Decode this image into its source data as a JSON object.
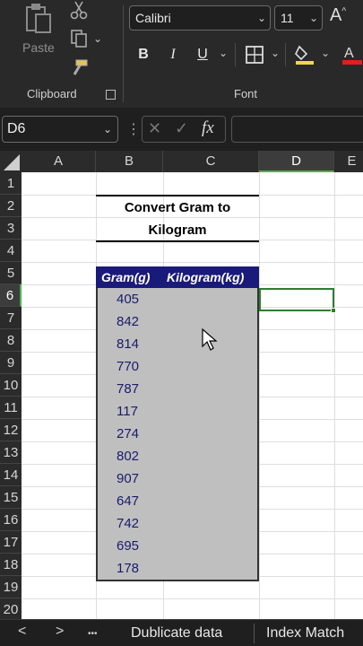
{
  "ribbon": {
    "clipboard_group": "Clipboard",
    "font_group": "Font",
    "paste_label": "Paste",
    "font_name": "Calibri",
    "font_size": "11",
    "bold": "B",
    "italic": "I",
    "underline": "U",
    "grow_font": "A",
    "icons": [
      "paste-icon",
      "cut-icon",
      "copy-icon",
      "format-painter-icon",
      "borders-icon",
      "fill-color-icon",
      "font-color-icon"
    ],
    "fill_color": "#f5d742",
    "font_color": "#e0201b"
  },
  "formula_bar": {
    "name_box": "D6",
    "fx": "fx",
    "cancel": "✕",
    "enter": "✓",
    "value": ""
  },
  "grid": {
    "columns": [
      "A",
      "B",
      "C",
      "D",
      "E"
    ],
    "selected_column": "D",
    "rows": [
      "1",
      "2",
      "3",
      "4",
      "5",
      "6",
      "7",
      "8",
      "9",
      "10",
      "11",
      "12",
      "13",
      "14",
      "15",
      "16",
      "17",
      "18",
      "19",
      "20"
    ],
    "selected_row": "6",
    "title_line1": "Convert  Gram to",
    "title_line2": "Kilogram",
    "header_gram": "Gram(g)",
    "header_kg": "Kilogram(kg)",
    "grams": [
      "405",
      "842",
      "814",
      "770",
      "787",
      "117",
      "274",
      "802",
      "907",
      "647",
      "742",
      "695",
      "178"
    ],
    "accent_color": "#1a1a7a"
  },
  "tabs": {
    "prev": "<",
    "next": ">",
    "more": "•••",
    "sheets": [
      "Dublicate data",
      "Index Match"
    ]
  }
}
